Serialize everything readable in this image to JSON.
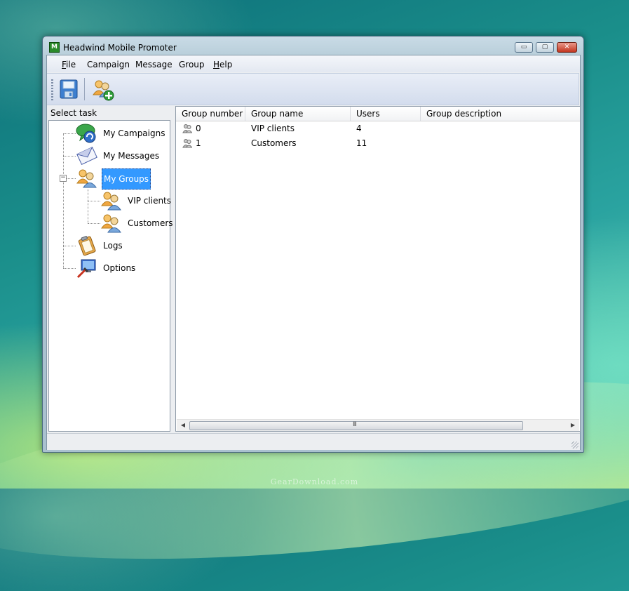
{
  "window": {
    "title": "Headwind Mobile Promoter",
    "minimize_glyph": "▭",
    "maximize_glyph": "▢",
    "close_glyph": "✕"
  },
  "menu": {
    "items": [
      {
        "underline": "F",
        "rest": "ile"
      },
      {
        "underline": "",
        "rest": "Campaign"
      },
      {
        "underline": "",
        "rest": "Message"
      },
      {
        "underline": "",
        "rest": "Group"
      },
      {
        "underline": "H",
        "rest": "elp"
      }
    ]
  },
  "toolbar": {
    "buttons": [
      {
        "icon": "save-icon"
      },
      {
        "icon": "add-group-icon"
      }
    ]
  },
  "sidebar": {
    "label": "Select task",
    "items": [
      {
        "label": "My Campaigns",
        "icon": "campaigns-icon"
      },
      {
        "label": "My Messages",
        "icon": "messages-icon"
      },
      {
        "label": "My Groups",
        "icon": "groups-icon",
        "selected": true,
        "expanded": true,
        "children": [
          {
            "label": "VIP clients",
            "icon": "group-icon"
          },
          {
            "label": "Customers",
            "icon": "group-icon"
          }
        ]
      },
      {
        "label": "Logs",
        "icon": "logs-icon"
      },
      {
        "label": "Options",
        "icon": "options-icon"
      }
    ],
    "collapse_glyph": "−"
  },
  "list": {
    "columns": [
      "Group number",
      "Group name",
      "Users",
      "Group description"
    ],
    "rows": [
      {
        "number": "0",
        "name": "VIP clients",
        "users": "4",
        "description": ""
      },
      {
        "number": "1",
        "name": "Customers",
        "users": "11",
        "description": ""
      }
    ],
    "scroll_left": "◀",
    "scroll_right": "▶",
    "thumb_grip": "III"
  },
  "watermark": "GearDownload.com"
}
